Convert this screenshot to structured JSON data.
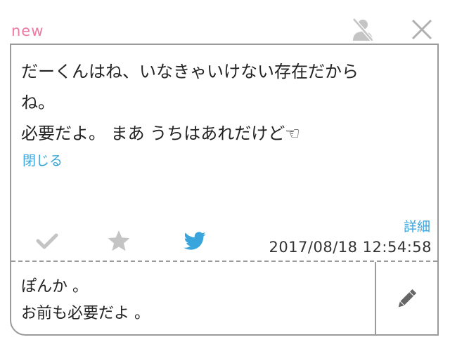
{
  "header": {
    "badge": "new",
    "icons": {
      "hide_user": "person-off-icon",
      "close": "close-icon"
    }
  },
  "post": {
    "message": "だーくんはね、いなきゃいけない存在だから\nね。\n必要だよ。 まあ うちはあれだけど☜",
    "collapse_label": "閉じる",
    "detail_label": "詳細",
    "timestamp": "2017/08/18 12:54:58",
    "actions": [
      "check-icon",
      "star-icon",
      "twitter-icon"
    ]
  },
  "reply": {
    "text": "ぽんか 。\nお前も必要だよ 。",
    "edit_icon": "pencil-icon"
  },
  "colors": {
    "badge": "#ee7aa3",
    "link": "#3aa5dd",
    "border": "#9a9a9a",
    "icon_gray": "#c4c4c4",
    "twitter": "#3aa5dd"
  }
}
